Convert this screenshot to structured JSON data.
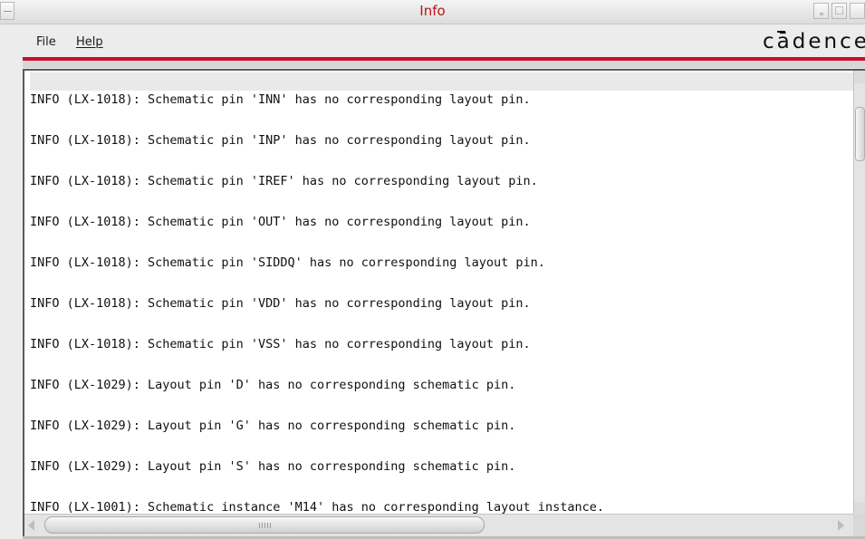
{
  "window": {
    "title": "Info",
    "title_color": "#b4160f"
  },
  "menubar": {
    "items": [
      {
        "label": "File"
      },
      {
        "label": "Help",
        "mnemonic": "H"
      }
    ],
    "logo": "cādence",
    "accent_color": "#c8102e"
  },
  "log": {
    "lines": [
      "INFO (LX-1018): Schematic pin 'INN' has no corresponding layout pin.",
      "INFO (LX-1018): Schematic pin 'INP' has no corresponding layout pin.",
      "INFO (LX-1018): Schematic pin 'IREF' has no corresponding layout pin.",
      "INFO (LX-1018): Schematic pin 'OUT' has no corresponding layout pin.",
      "INFO (LX-1018): Schematic pin 'SIDDQ' has no corresponding layout pin.",
      "INFO (LX-1018): Schematic pin 'VDD' has no corresponding layout pin.",
      "INFO (LX-1018): Schematic pin 'VSS' has no corresponding layout pin.",
      "INFO (LX-1029): Layout pin 'D' has no corresponding schematic pin.",
      "INFO (LX-1029): Layout pin 'G' has no corresponding schematic pin.",
      "INFO (LX-1029): Layout pin 'S' has no corresponding schematic pin.",
      "INFO (LX-1001): Schematic instance 'M14' has no corresponding layout instance."
    ]
  },
  "icons": {
    "window_menu": "window-menu-icon",
    "minimize": "minimize-icon",
    "maximize": "maximize-icon",
    "close": "close-icon"
  }
}
